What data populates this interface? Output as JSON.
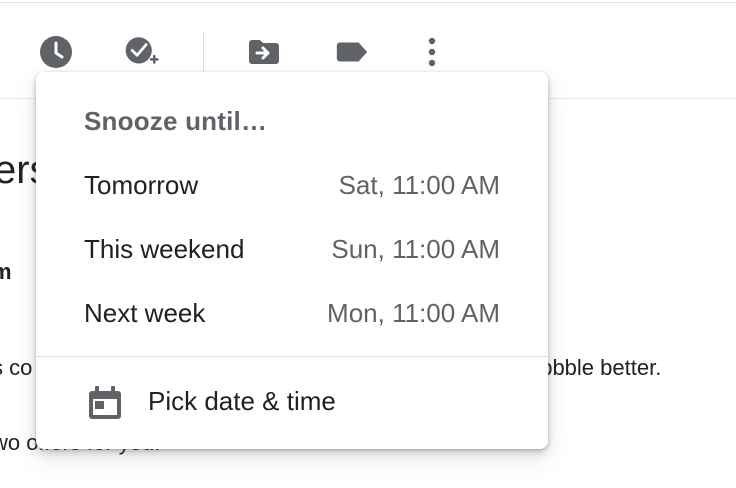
{
  "toolbar": {
    "icons": [
      "clock-icon",
      "add-task-icon",
      "move-to-icon",
      "label-icon",
      "more-vert-icon"
    ],
    "icon_color": "#5f6368"
  },
  "background": {
    "heading_fragment": "ers",
    "bold_fragment": "m",
    "line1_left": "s co",
    "line1_right": "ribbble better.",
    "line2": "wo offers for you."
  },
  "snooze_menu": {
    "title": "Snooze until…",
    "options": [
      {
        "label": "Tomorrow",
        "time": "Sat, 11:00 AM"
      },
      {
        "label": "This weekend",
        "time": "Sun, 11:00 AM"
      },
      {
        "label": "Next week",
        "time": "Mon, 11:00 AM"
      }
    ],
    "pick": {
      "label": "Pick date & time",
      "icon": "calendar-icon"
    }
  }
}
